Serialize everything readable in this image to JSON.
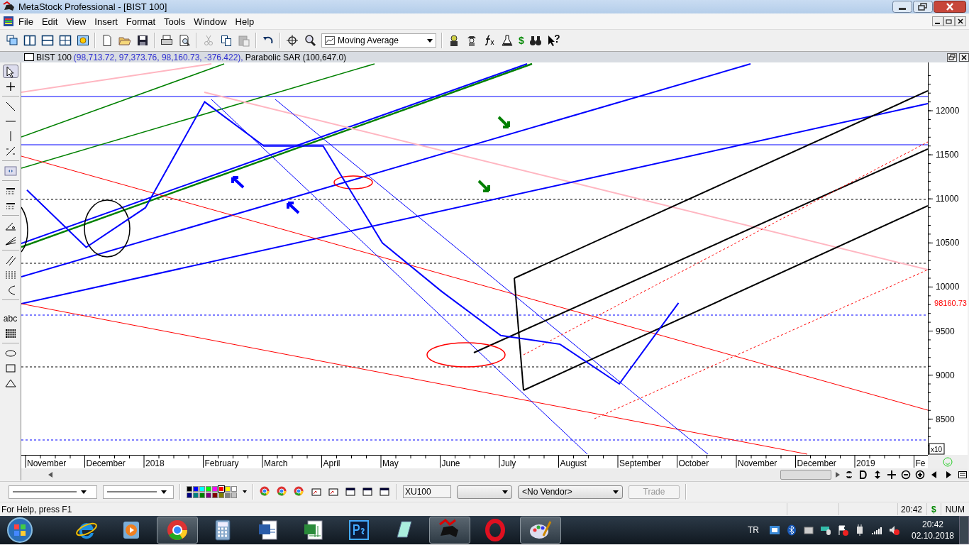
{
  "window": {
    "title": "MetaStock Professional - [BIST 100]"
  },
  "menu": [
    "File",
    "Edit",
    "View",
    "Insert",
    "Format",
    "Tools",
    "Window",
    "Help"
  ],
  "toolbar": {
    "indicator_dropdown": "Moving Average",
    "money_glyph": "$"
  },
  "chart_window": {
    "price_values": "(98,713.72, 97,373.76, 98,160.73, -376.422),",
    "indicator": "Parabolic SAR",
    "indicator_values": "(100,647.0)",
    "last_price": "98160.73",
    "scale_multiplier": "x10",
    "chart_data": {
      "type": "line",
      "categories": [
        "November",
        "December",
        "2018",
        "February",
        "March",
        "April",
        "May",
        "June",
        "July",
        "August",
        "September",
        "October",
        "November",
        "December",
        "2019",
        "Fe"
      ],
      "series": [
        {
          "name": "BIST 100",
          "color": "#0000ff",
          "values": [
            11100,
            10450,
            10900,
            12100,
            11600,
            11600,
            10500,
            9950,
            9450,
            9350,
            8900,
            9820,
            null,
            null,
            null,
            null
          ]
        }
      ],
      "ylim": [
        8095,
        12548
      ],
      "yticks": [
        8500,
        9000,
        9500,
        10000,
        10500,
        11000,
        11500,
        12000
      ]
    }
  },
  "drawing_tools": [
    {
      "selected": true
    },
    {
      "selected": false
    },
    {
      "selected": false
    },
    {
      "selected": false
    },
    {
      "selected": false
    },
    {
      "selected": false
    },
    {
      "selected": false
    },
    {
      "selected": false
    },
    {
      "selected": false
    },
    {
      "selected": false
    },
    {
      "selected": false
    },
    {
      "selected": false
    },
    {
      "selected": false
    },
    {
      "selected": false
    },
    {
      "selected": false,
      "label": "abc"
    },
    {
      "selected": false
    },
    {
      "selected": false
    },
    {
      "selected": false
    },
    {
      "selected": false
    }
  ],
  "bottom_toolbar": {
    "palette": [
      {
        "color": "#000000",
        "selected": false
      },
      {
        "color": "#0000ff",
        "selected": false
      },
      {
        "color": "#00ffff",
        "selected": false
      },
      {
        "color": "#00ff00",
        "selected": false
      },
      {
        "color": "#ff00ff",
        "selected": false
      },
      {
        "color": "#ff0000",
        "selected": true
      },
      {
        "color": "#ffff00",
        "selected": false
      },
      {
        "color": "#ffffff",
        "selected": false
      },
      {
        "color": "#000080",
        "selected": false
      },
      {
        "color": "#008080",
        "selected": false
      },
      {
        "color": "#008000",
        "selected": false
      },
      {
        "color": "#800080",
        "selected": false
      },
      {
        "color": "#800000",
        "selected": false
      },
      {
        "color": "#808000",
        "selected": false
      },
      {
        "color": "#808080",
        "selected": false
      },
      {
        "color": "#c0c0c0",
        "selected": false
      }
    ],
    "symbol_field": "XU100",
    "vendor_dropdown": "<No Vendor>",
    "trade_button": {
      "label": "Trade",
      "disabled": true
    }
  },
  "status_bar": {
    "help": "For Help, press F1",
    "time": "20:42",
    "money_glyph": "$",
    "num": "NUM"
  },
  "taskbar": {
    "apps": [
      {
        "running": false
      },
      {
        "running": false
      },
      {
        "running": true
      },
      {
        "running": false
      },
      {
        "running": false
      },
      {
        "running": false
      },
      {
        "running": false
      },
      {
        "running": false
      },
      {
        "running": true
      },
      {
        "running": false
      },
      {
        "running": true
      }
    ],
    "language": "TR",
    "clock_time": "20:42",
    "clock_date": "02.10.2018"
  }
}
